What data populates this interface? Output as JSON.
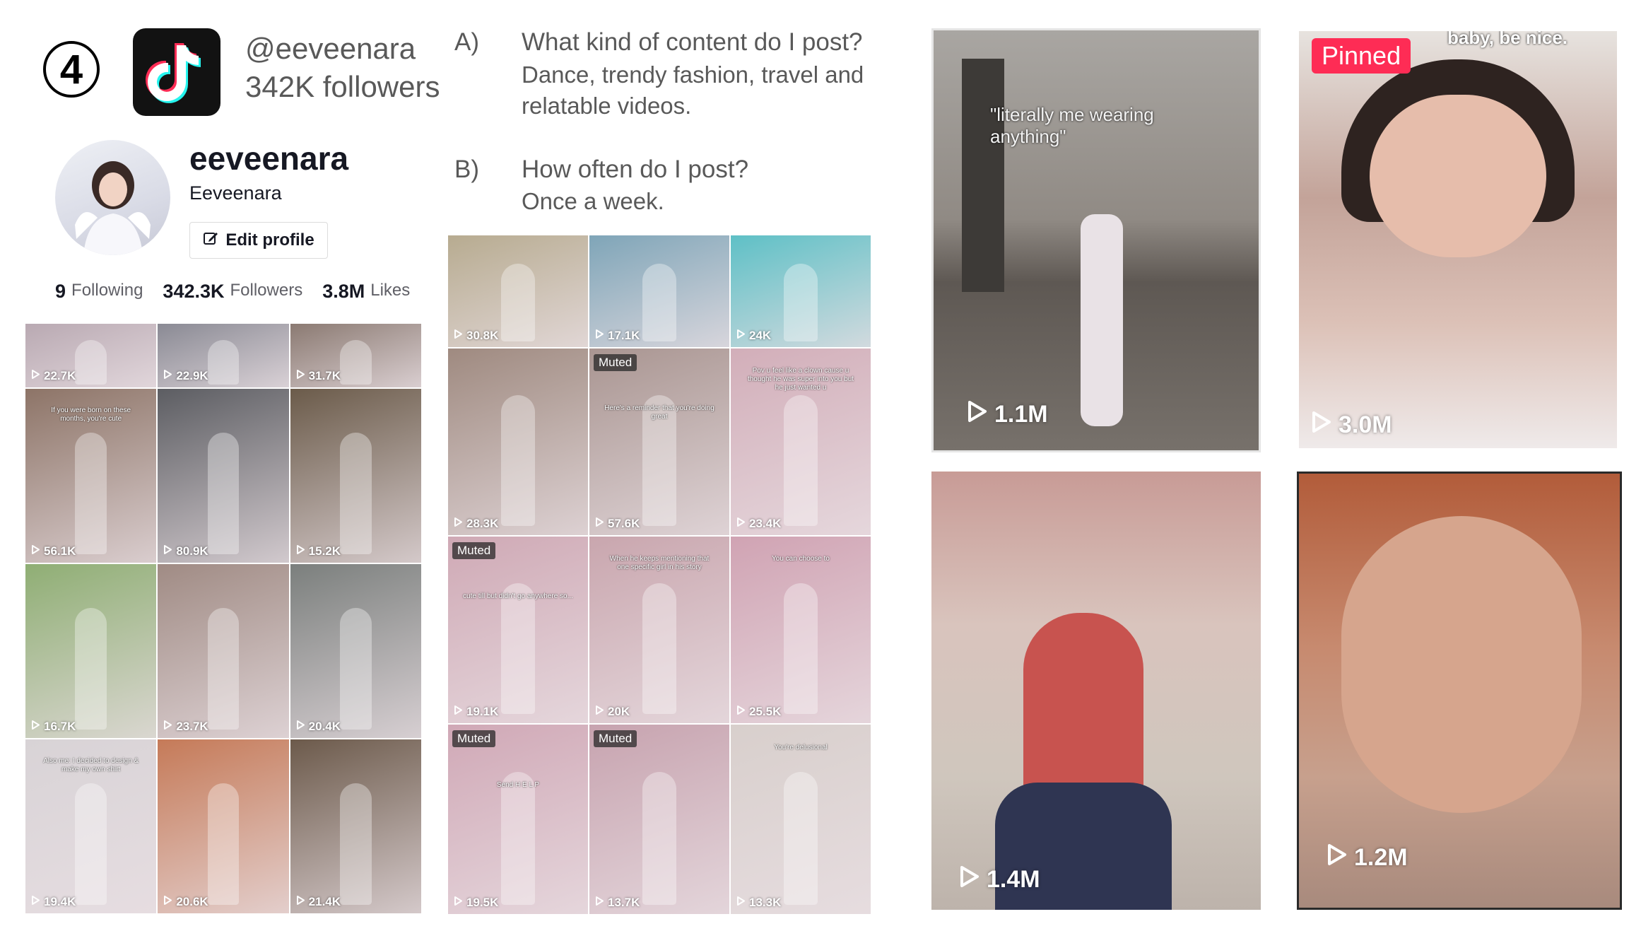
{
  "number_badge": "4",
  "account": {
    "handle": "@eeveenara",
    "followers_line": "342K followers",
    "username": "eeveenara",
    "display_name": "Eeveenara",
    "edit_profile_label": "Edit profile"
  },
  "stats": {
    "following_count": "9",
    "following_label": "Following",
    "followers_count": "342.3K",
    "followers_label": "Followers",
    "likes_count": "3.8M",
    "likes_label": "Likes"
  },
  "qa": {
    "a_label": "A)",
    "a_question": "What kind of content do I post?",
    "a_answer_line1": "Dance, trendy fashion, travel and",
    "a_answer_line2": "relatable videos.",
    "b_label": "B)",
    "b_question": "How often do I post?",
    "b_answer": "Once a week."
  },
  "grid_left": {
    "tiles": [
      {
        "views": "22.7K",
        "color": "#b9a9b2"
      },
      {
        "views": "22.9K",
        "color": "#8a8a94"
      },
      {
        "views": "31.7K",
        "color": "#8b7a72"
      },
      {
        "views": "56.1K",
        "color": "#8d7467",
        "caption": "If you were born on these months, you're cute"
      },
      {
        "views": "80.9K",
        "color": "#5c5d62"
      },
      {
        "views": "15.2K",
        "color": "#6b5b4a"
      },
      {
        "views": "16.7K",
        "color": "#8fae74"
      },
      {
        "views": "23.7K",
        "color": "#a08b84"
      },
      {
        "views": "20.4K",
        "color": "#7b7f7d"
      },
      {
        "views": "19.4K",
        "color": "#d8d3d6",
        "caption": "Also me: I decided to design & make my own shirt"
      },
      {
        "views": "20.6K",
        "color": "#c57a58"
      },
      {
        "views": "21.4K",
        "color": "#6c5a4b"
      }
    ]
  },
  "grid_mid": {
    "tiles": [
      {
        "views": "30.8K",
        "color": "#b7ab90"
      },
      {
        "views": "17.1K",
        "color": "#7fa5b8"
      },
      {
        "views": "24K",
        "color": "#5ec0c6"
      },
      {
        "views": "28.3K",
        "color": "#9f8a80"
      },
      {
        "views": "57.6K",
        "color": "#a99591",
        "tag": "Muted",
        "caption": "Here's a reminder that you're doing great"
      },
      {
        "views": "23.4K",
        "color": "#d2aeb9",
        "caption": "Pov u feel like a clown cause u thought he was super into you but he just wanted u"
      },
      {
        "views": "19.1K",
        "color": "#cfa9b5",
        "tag": "Muted",
        "caption": "cute till but didn't go anywhere so..."
      },
      {
        "views": "20K",
        "color": "#c9a6ae",
        "caption": "When he keeps mentioning that one specific girl in his story"
      },
      {
        "views": "25.5K",
        "color": "#d0a3b3",
        "caption": "You can choose to"
      },
      {
        "views": "19.5K",
        "color": "#d0a8b6",
        "tag": "Muted",
        "caption": "Send H E L P"
      },
      {
        "views": "13.7K",
        "color": "#c7a3af",
        "tag": "Muted"
      },
      {
        "views": "13.3K",
        "color": "#d8cfcc",
        "caption": "You're delusional"
      }
    ]
  },
  "featured": {
    "v1": {
      "views": "1.1M",
      "overlay": "\"literally me wearing anything\"",
      "color": "#9b9691"
    },
    "v2": {
      "views": "3.0M",
      "pinned": "Pinned",
      "overlay": "baby, be nice.",
      "color": "#c7a99d"
    },
    "v3": {
      "views": "1.4M",
      "color": "#b7938e"
    },
    "v4": {
      "views": "1.2M",
      "color": "#b27158"
    }
  },
  "colors": {
    "tiktok_red": "#fe2c55",
    "tiktok_cyan": "#25f4ee",
    "text_gray": "#595959"
  }
}
